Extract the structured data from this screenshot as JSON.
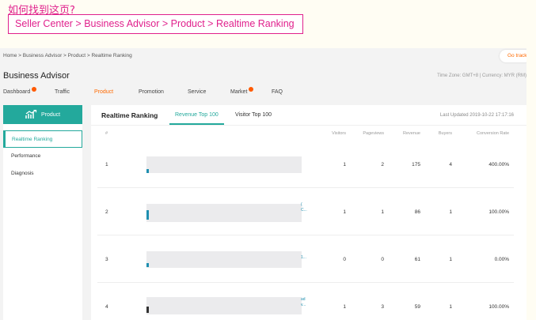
{
  "note": {
    "title": "如何找到这页?",
    "path": "Seller Center > Business Advisor > Product > Realtime Ranking"
  },
  "breadcrumb": {
    "text": "Home  >  Business Advisor  >  Product  >  Realtime Ranking"
  },
  "go_back": "Go track",
  "header": {
    "title": "Business Advisor",
    "timezone": "Time Zone: GMT+8 | Currency: MYR (RM)"
  },
  "main_nav": {
    "items": [
      {
        "label": "Dashboard",
        "dot": true
      },
      {
        "label": "Traffic",
        "dot": false
      },
      {
        "label": "Product",
        "dot": false,
        "active": true
      },
      {
        "label": "Promotion",
        "dot": false
      },
      {
        "label": "Service",
        "dot": false
      },
      {
        "label": "Market",
        "dot": true
      },
      {
        "label": "FAQ",
        "dot": false
      }
    ],
    "accent_color": "#ff6a00"
  },
  "sidebar": {
    "product_label": "Product",
    "items": [
      {
        "label": "Realtime Ranking",
        "active": true
      },
      {
        "label": "Performance"
      },
      {
        "label": "Diagnosis"
      }
    ],
    "accent_color": "#23a99c"
  },
  "tabs": {
    "heading": "Realtime Ranking",
    "items": [
      {
        "label": "Revenue Top 100",
        "active": true
      },
      {
        "label": "Visitor Top 100"
      }
    ],
    "last_updated": "Last Updated 2019-10-22 17:17:16"
  },
  "table": {
    "headers": [
      "#",
      "Visitors",
      "Pageviews",
      "Revenue",
      "Buyers",
      "Conversion Rate"
    ],
    "rows": [
      {
        "rank": "1",
        "visitors": "1",
        "pageviews": "2",
        "revenue": "175",
        "buyers": "4",
        "conversion": "400.00%",
        "link": ""
      },
      {
        "rank": "2",
        "visitors": "1",
        "pageviews": "1",
        "revenue": "86",
        "buyers": "1",
        "conversion": "100.00%",
        "link": "(\nC..."
      },
      {
        "rank": "3",
        "visitors": "0",
        "pageviews": "0",
        "revenue": "61",
        "buyers": "1",
        "conversion": "0.00%",
        "link": "1..."
      },
      {
        "rank": "4",
        "visitors": "1",
        "pageviews": "3",
        "revenue": "59",
        "buyers": "1",
        "conversion": "100.00%",
        "link": "ad\nv..."
      }
    ]
  }
}
